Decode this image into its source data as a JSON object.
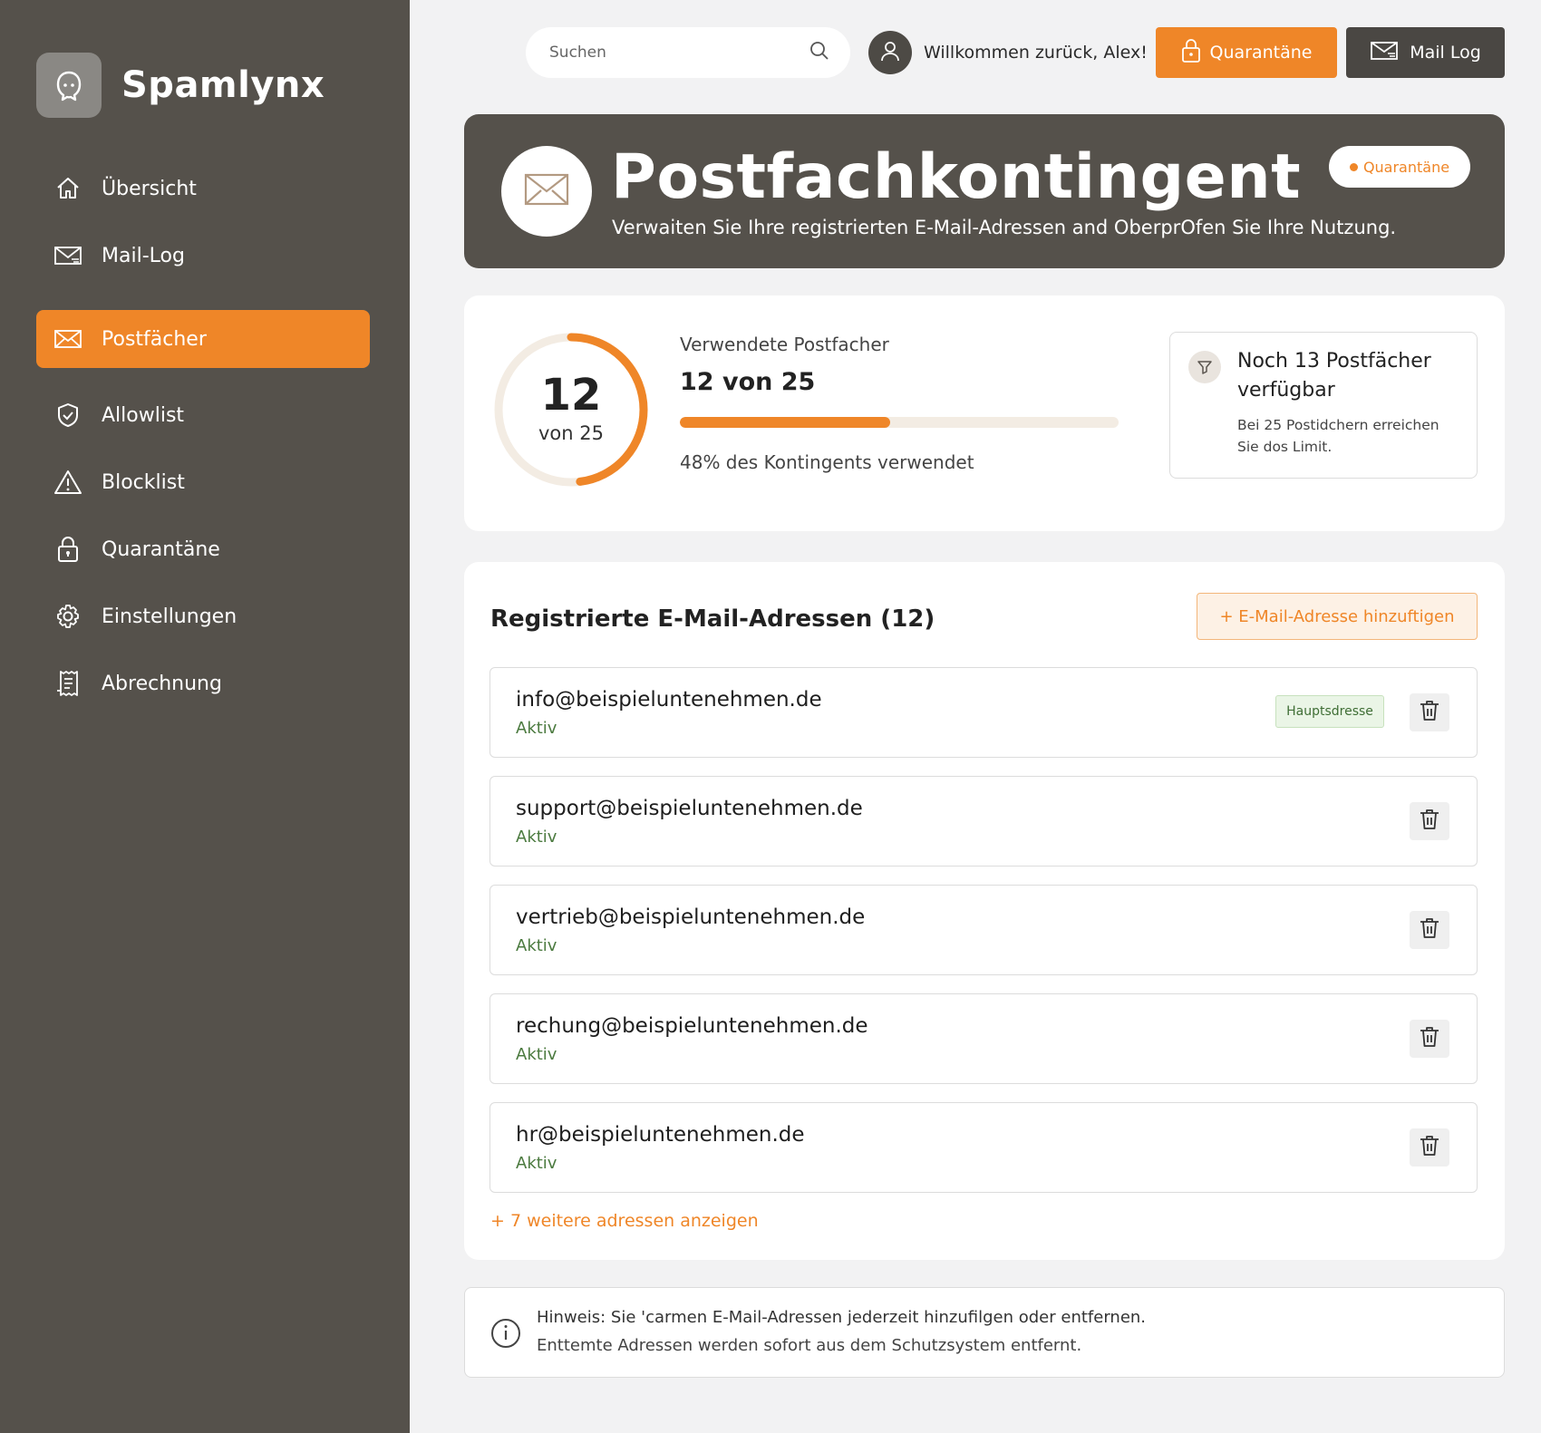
{
  "app": {
    "name": "Spamlynx"
  },
  "sidebar": {
    "items": [
      {
        "label": "Übersicht",
        "icon": "home-icon"
      },
      {
        "label": "Mail-Log",
        "icon": "mail-log-icon"
      },
      {
        "label": "Postfächer",
        "icon": "envelope-icon",
        "active": true
      },
      {
        "label": "Allowlist",
        "icon": "shield-check-icon"
      },
      {
        "label": "Blocklist",
        "icon": "warning-icon"
      },
      {
        "label": "Quarantäne",
        "icon": "lock-icon"
      },
      {
        "label": "Einstellungen",
        "icon": "gear-icon"
      },
      {
        "label": "Abrechnung",
        "icon": "receipt-icon"
      }
    ]
  },
  "header": {
    "search_placeholder": "Suchen",
    "welcome": "Willkommen zurück, Alex!",
    "quarantine_button": "Quarantäne",
    "maillog_button": "Mail Log"
  },
  "hero": {
    "title": "Postfachkontingent",
    "subtitle": "Verwaiten Sie Ihre registrierten E-Mail-Adressen and OberprOfen Sie Ihre Nutzung.",
    "pill": "Quarantäne"
  },
  "quota": {
    "used": "12",
    "of_label": "von 25",
    "label": "Verwendete Postfacher",
    "value": "12 von 25",
    "fraction": 0.48,
    "percent_text": "48% des Kontingents verwendet",
    "available_title": "Noch 13 Postfächer verfügbar",
    "available_desc": "Bei 25 Postidchern erreichen Sie dos Limit."
  },
  "addresses": {
    "title": "Registrierte E-Mail-Adressen (12)",
    "add_button": "+ E-Mail-Adresse hinzuftigen",
    "rows": [
      {
        "email": "info@beispieluntenehmen.de",
        "status": "Aktiv",
        "badge": "Hauptsdresse"
      },
      {
        "email": "support@beispieluntenehmen.de",
        "status": "Aktiv"
      },
      {
        "email": "vertrieb@beispieluntenehmen.de",
        "status": "Aktiv"
      },
      {
        "email": "rechung@beispieluntenehmen.de",
        "status": "Aktiv"
      },
      {
        "email": "hr@beispieluntenehmen.de",
        "status": "Aktiv"
      }
    ],
    "more": "+ 7 weitere adressen anzeigen"
  },
  "note": {
    "line1": "Hinweis: Sie 'carmen E-Mail-Adressen jederzeit hinzufilgen oder entfernen.",
    "line2": "Enttemte Adressen werden sofort aus dem Schutzsystem entfernt."
  },
  "colors": {
    "accent": "#ef8628",
    "sidebar": "#55514b",
    "status_green": "#4b7a3f"
  }
}
